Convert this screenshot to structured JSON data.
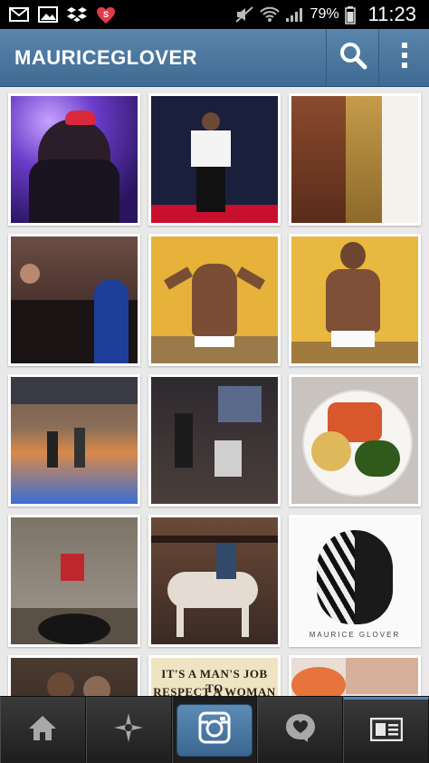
{
  "status_bar": {
    "battery_percent": "79%",
    "time": "11:23",
    "icons": [
      "mail-icon",
      "image-icon",
      "dropbox-icon",
      "shop-icon",
      "mute-icon",
      "wifi-icon",
      "signal-icon",
      "battery-icon"
    ]
  },
  "header": {
    "username": "MAURICEGLOVER",
    "search_icon": "search-icon",
    "menu_icon": "more-vertical-icon"
  },
  "photos": [
    {
      "caption": ""
    },
    {
      "caption": ""
    },
    {
      "caption": ""
    },
    {
      "caption": ""
    },
    {
      "caption": ""
    },
    {
      "caption": ""
    },
    {
      "caption": ""
    },
    {
      "caption": ""
    },
    {
      "caption": ""
    },
    {
      "caption": ""
    },
    {
      "caption": ""
    },
    {
      "caption": "MAURICE GLOVER"
    },
    {
      "caption": ""
    },
    {
      "caption_line1": "IT'S A MAN'S JOB TO",
      "caption_line2": "RESPECT A WOMAN"
    },
    {
      "caption": ""
    }
  ],
  "bottom_nav": {
    "items": [
      "home-icon",
      "explore-icon",
      "camera-icon",
      "activity-icon",
      "profile-icon"
    ],
    "active": "profile-icon"
  },
  "colors": {
    "header": "#4a76a0",
    "accent": "#4f85b8",
    "nav": "#2a2a2a"
  }
}
